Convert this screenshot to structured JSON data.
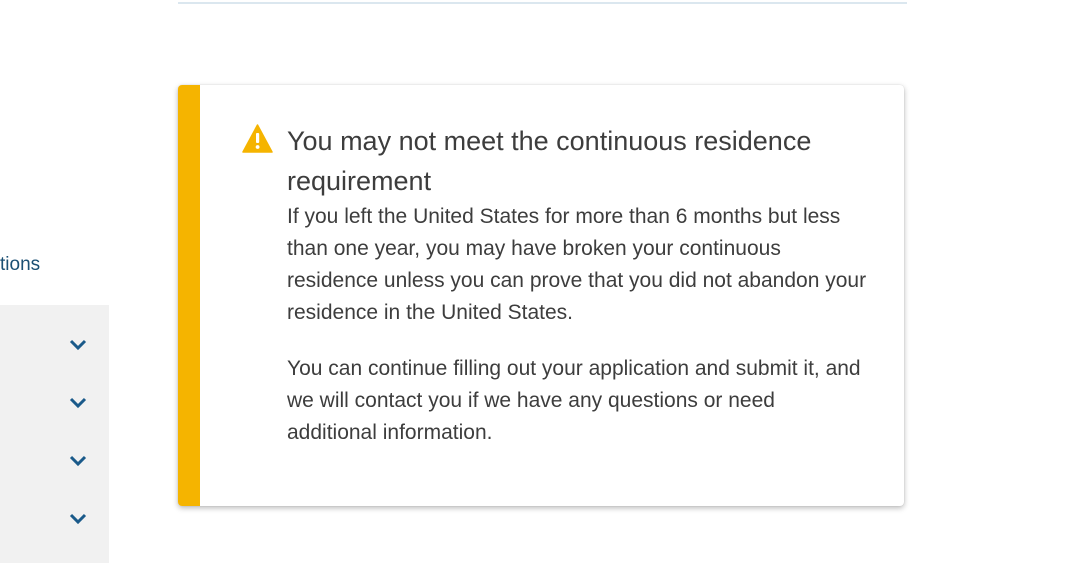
{
  "sidebar": {
    "link_label": "tions",
    "accordion_rows": [
      {
        "icon": "chevron-down-icon"
      },
      {
        "icon": "chevron-down-icon"
      },
      {
        "icon": "chevron-down-icon"
      },
      {
        "icon": "chevron-down-icon"
      }
    ]
  },
  "alert": {
    "type": "warning",
    "icon": "warning-icon",
    "accent_color": "#f5b400",
    "title": "You may not meet the continuous residence requirement",
    "paragraphs": [
      "If you left the United States for more than 6 months but less than one year, you may have broken your continuous residence unless you can prove that you did not abandon your residence in the United States.",
      "You can continue filling out your application and submit it, and we will contact you if we have any questions or need additional information."
    ]
  },
  "colors": {
    "link": "#1a4f73",
    "sidebar_bg": "#f1f1f1",
    "text": "#3d3d3d"
  }
}
